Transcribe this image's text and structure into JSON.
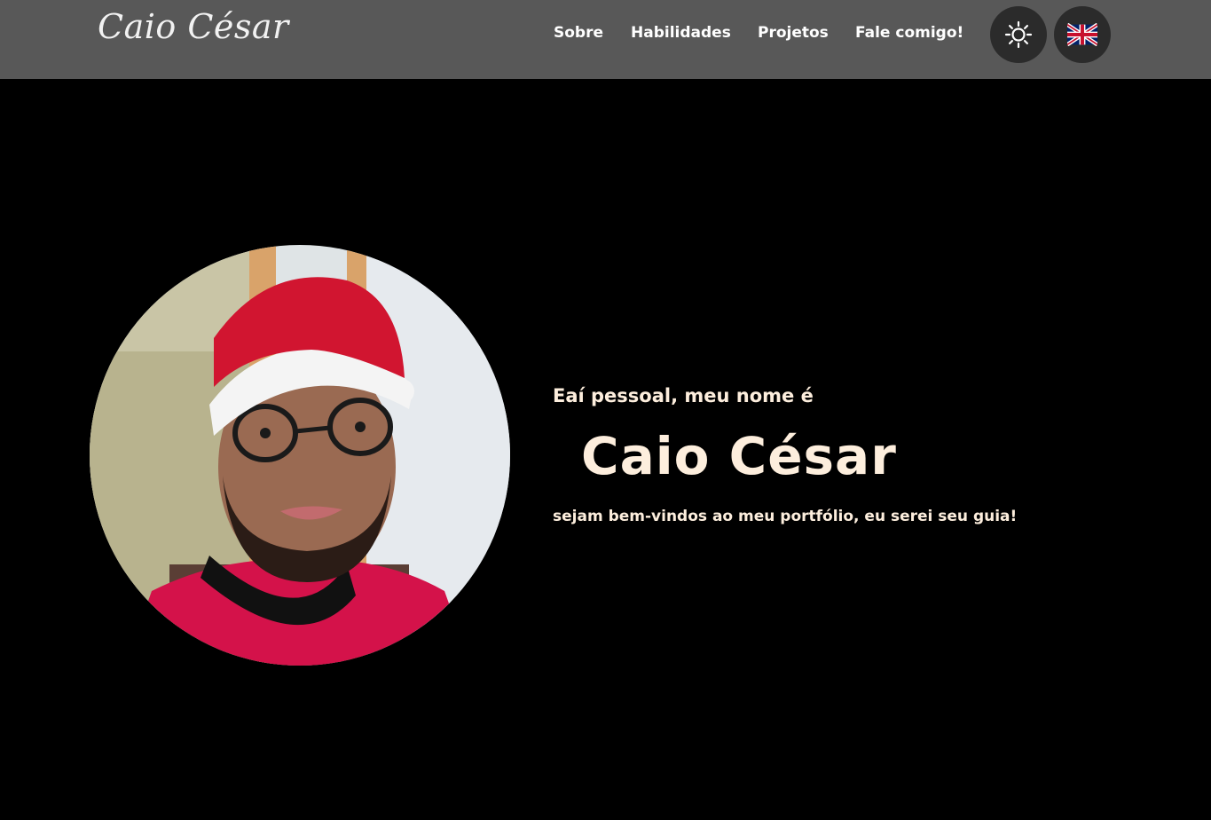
{
  "header": {
    "logo_text": "Caio César",
    "nav": {
      "sobre": "Sobre",
      "habilidades": "Habilidades",
      "projetos": "Projetos",
      "fale": "Fale comigo!"
    },
    "theme_toggle_icon": "sun-icon",
    "language_icon": "uk-flag-icon"
  },
  "hero": {
    "greeting": "Eaí pessoal, meu nome é",
    "name": "Caio César",
    "subtitle": "sejam bem-vindos ao meu portfólio, eu serei seu guia!",
    "photo_alt": "Caio César"
  },
  "colors": {
    "navbar_bg": "#585858",
    "page_bg": "#000000",
    "accent_text": "#fdeedd",
    "button_bg": "#2b2b2b"
  }
}
